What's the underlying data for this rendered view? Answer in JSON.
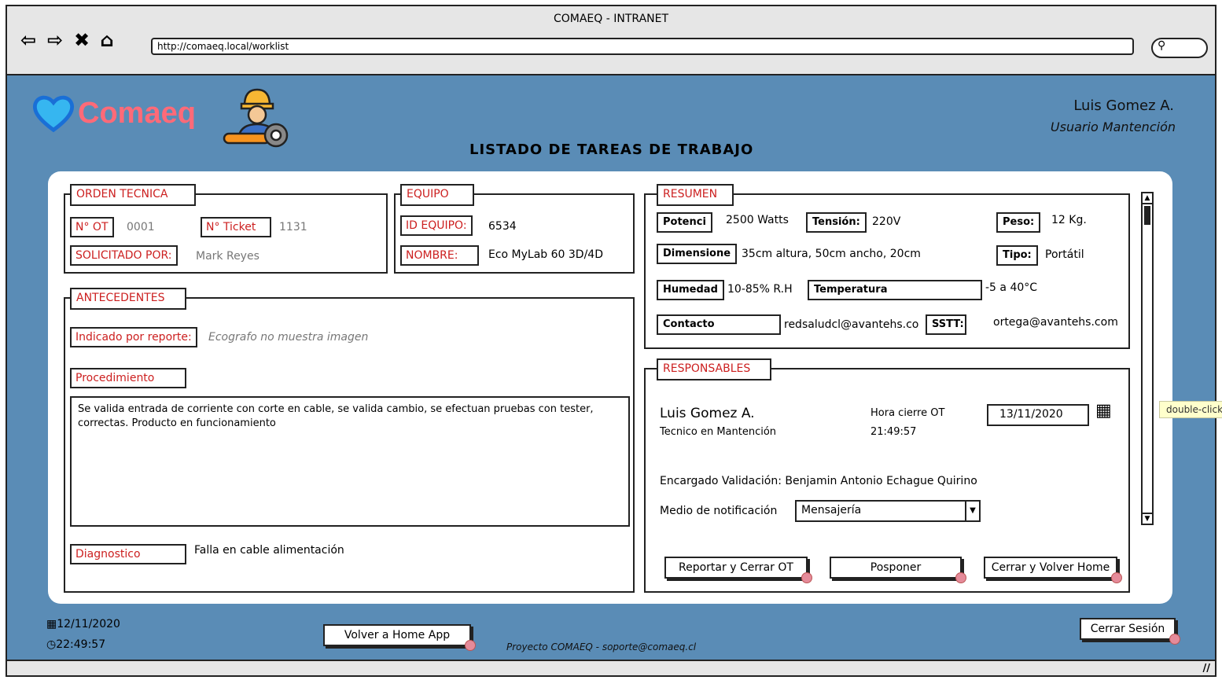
{
  "window": {
    "title": "COMAEQ - INTRANET",
    "url": "http://comaeq.local/worklist",
    "search_icon": "search-icon"
  },
  "header": {
    "logo_text": "Comaeq",
    "page_title": "LISTADO DE TAREAS DE TRABAJO",
    "user_name": "Luis Gomez A.",
    "user_role": "Usuario Mantención"
  },
  "orden": {
    "legend": "ORDEN TECNICA",
    "ot_label": "N° OT",
    "ot_value": "0001",
    "ticket_label": "N° Ticket",
    "ticket_value": "1131",
    "solicitado_label": "SOLICITADO POR:",
    "solicitado_value": "Mark Reyes"
  },
  "equipo": {
    "legend": "EQUIPO",
    "id_label": "ID EQUIPO:",
    "id_value": "6534",
    "nombre_label": "NOMBRE:",
    "nombre_value": "Eco MyLab 60 3D/4D"
  },
  "antecedentes": {
    "legend": "ANTECEDENTES",
    "reporte_label": "Indicado por reporte:",
    "reporte_value": "Ecografo no muestra imagen",
    "procedimiento_label": "Procedimiento",
    "procedimiento_text": "Se valida entrada de corriente con corte en cable, se valida cambio, se efectuan pruebas con tester, correctas. Producto en funcionamiento",
    "diagnostico_label": "Diagnostico",
    "diagnostico_value": "Falla en cable alimentación"
  },
  "resumen": {
    "legend": "RESUMEN",
    "potencia_label": "Potenci",
    "potencia_value": "2500 Watts",
    "tension_label": "Tensión:",
    "tension_value": "220V",
    "peso_label": "Peso:",
    "peso_value": "12 Kg.",
    "dimension_label": "Dimensione",
    "dimension_value": "35cm altura, 50cm ancho, 20cm",
    "tipo_label": "Tipo:",
    "tipo_value": "Portátil",
    "humedad_label": "Humedad",
    "humedad_value": "10-85% R.H",
    "temperatura_label": "Temperatura",
    "temperatura_value": "-5 a 40°C",
    "contacto_label": "Contacto",
    "contacto_value": "redsaludcl@avantehs.co",
    "sstt_label": "SSTT:",
    "sstt_value": "ortega@avantehs.com"
  },
  "responsables": {
    "legend": "RESPONSABLES",
    "name": "Luis Gomez A.",
    "role": "Tecnico en Mantención",
    "hora_label": "Hora cierre OT",
    "hora_value": "21:49:57",
    "fecha_value": "13/11/2020",
    "encargado": "Encargado Validación: Benjamin Antonio Echague Quirino",
    "medio_label": "Medio de notificación",
    "medio_value": "Mensajería",
    "btn_reportar": "Reportar y Cerrar OT",
    "btn_posponer": "Posponer",
    "btn_cerrar": "Cerrar y Volver Home"
  },
  "tooltip": "double-click",
  "footer": {
    "date": "12/11/2020",
    "time": "22:49:57",
    "btn_home": "Volver a Home App",
    "project": "Proyecto COMAEQ - soporte@comaeq.cl",
    "btn_logout": "Cerrar Sesión"
  }
}
